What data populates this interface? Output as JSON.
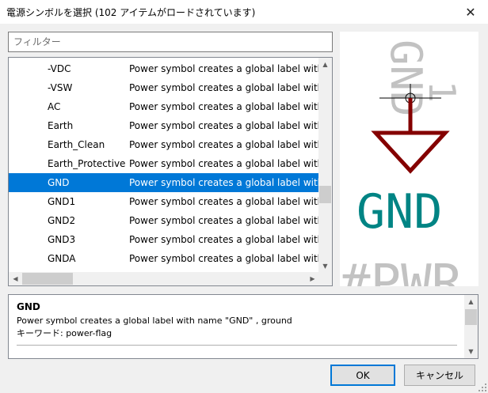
{
  "window": {
    "title": "電源シンボルを選択 (102 アイテムがロードされています)",
    "close_glyph": "✕"
  },
  "filter": {
    "placeholder": "フィルター",
    "value": ""
  },
  "list": {
    "rows": [
      {
        "name": "-VDC",
        "desc": "Power symbol creates a global label with"
      },
      {
        "name": "-VSW",
        "desc": "Power symbol creates a global label with"
      },
      {
        "name": "AC",
        "desc": "Power symbol creates a global label with"
      },
      {
        "name": "Earth",
        "desc": "Power symbol creates a global label with"
      },
      {
        "name": "Earth_Clean",
        "desc": "Power symbol creates a global label with"
      },
      {
        "name": "Earth_Protective",
        "desc": "Power symbol creates a global label with"
      },
      {
        "name": "GND",
        "desc": "Power symbol creates a global label with",
        "selected": true
      },
      {
        "name": "GND1",
        "desc": "Power symbol creates a global label with"
      },
      {
        "name": "GND2",
        "desc": "Power symbol creates a global label with"
      },
      {
        "name": "GND3",
        "desc": "Power symbol creates a global label with"
      },
      {
        "name": "GNDA",
        "desc": "Power symbol creates a global label with"
      }
    ],
    "scroll_up_icon": "▲",
    "scroll_down_icon": "▼",
    "scroll_left_icon": "◀",
    "scroll_right_icon": "▶"
  },
  "preview": {
    "symbol_value": "GND",
    "ref_text": "#PWR",
    "pin_name": "GND",
    "pin_num": "1",
    "colors": {
      "body": "#840000",
      "value": "#008484",
      "ghost": "#c2c2c2"
    }
  },
  "info": {
    "name": "GND",
    "description": "Power symbol creates a global label with name \"GND\" , ground",
    "keywords": "キーワード: power-flag"
  },
  "buttons": {
    "ok": "OK",
    "cancel": "キャンセル"
  },
  "colors": {
    "selection": "#0078d7",
    "background": "#f0f0f0"
  }
}
